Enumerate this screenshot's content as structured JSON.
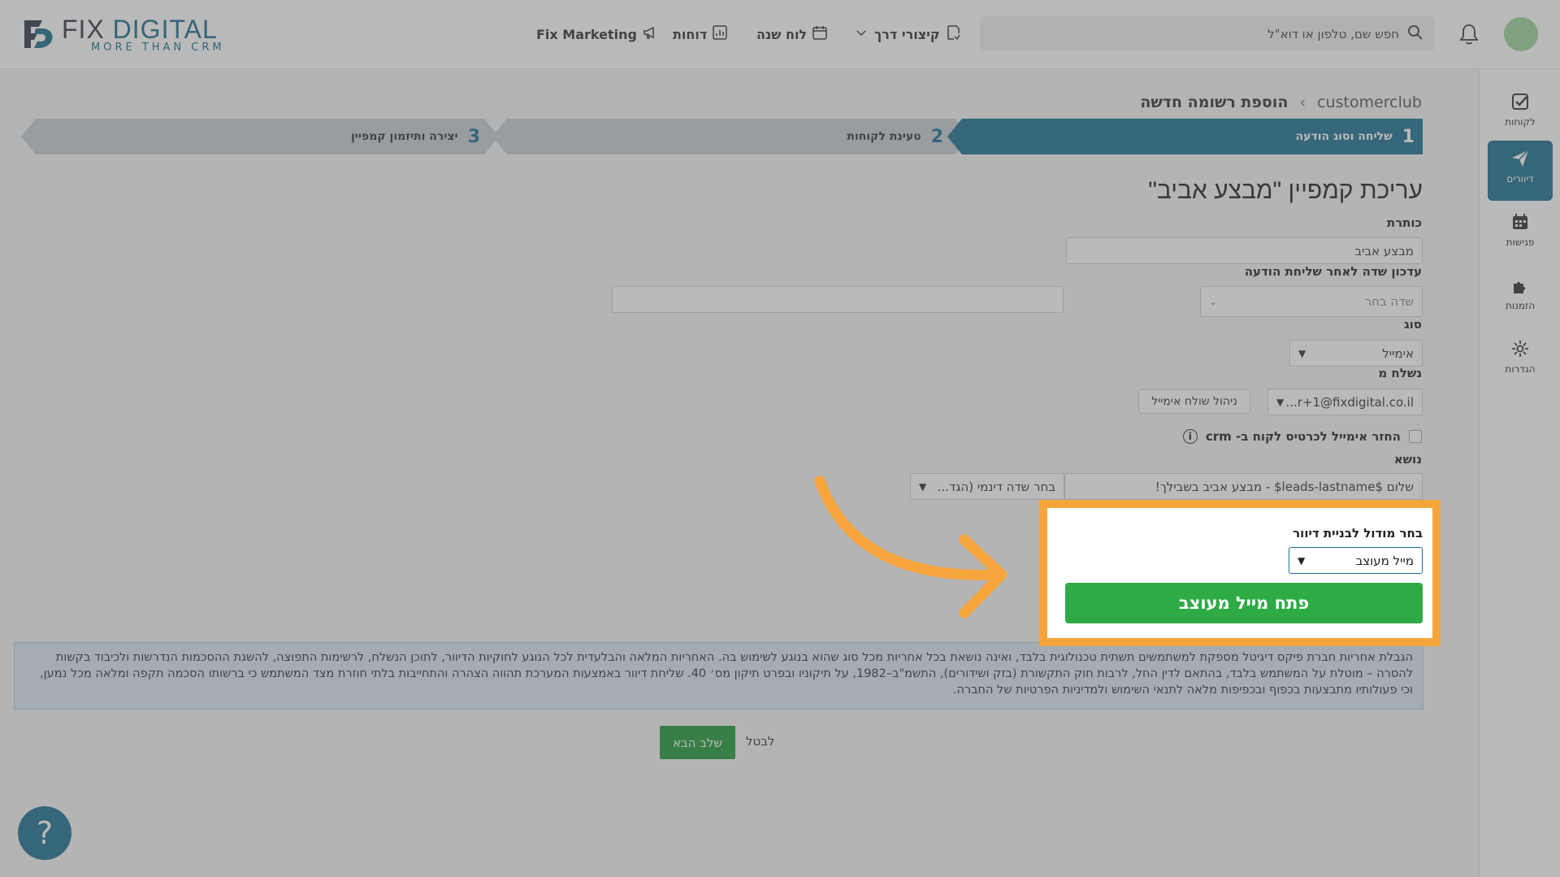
{
  "header": {
    "logo_title_a": "FIX ",
    "logo_title_b": "DIGITAL",
    "logo_sub": "MORE THAN CRM",
    "nav": {
      "marketing": "Fix Marketing",
      "reports": "דוחות",
      "calendar": "לוח שנה",
      "shortcuts": "קיצורי דרך"
    },
    "search_placeholder": "חפש שם, טלפון או דוא\"ל"
  },
  "sidebar": {
    "items": [
      {
        "label": "לקוחות",
        "icon": "checkbox-icon"
      },
      {
        "label": "דיוורים",
        "icon": "send-icon"
      },
      {
        "label": "פגישות",
        "icon": "calendar-icon"
      },
      {
        "label": "הזמנות",
        "icon": "puzzle-icon"
      },
      {
        "label": "הגדרות",
        "icon": "gear-icon"
      }
    ]
  },
  "breadcrumb": {
    "root": "customerclub",
    "separator": "›",
    "current": "הוספת רשומה חדשה"
  },
  "steps": [
    {
      "num": "1",
      "label": "שליחה וסוג הודעה"
    },
    {
      "num": "2",
      "label": "טעינת לקוחות"
    },
    {
      "num": "3",
      "label": "יצירה ותיזמון קמפיין"
    }
  ],
  "page_title": "עריכת קמפיין \"מבצע אביב\"",
  "form": {
    "title_label": "כותרת",
    "title_value": "מבצע אביב",
    "update_label": "עדכון שדה לאחר שליחת הודעה",
    "update_placeholder": "שדה בחר",
    "type_label": "סוג",
    "type_value": "אימייל",
    "from_label": "נשלח מ",
    "from_value": "r+1@fixdigital.co.il...",
    "manage_sender": "ניהול שולח אימייל",
    "return_email": "החזר אימייל לכרטיס לקוח ב- crm",
    "subject_label": "נושא",
    "subject_value": "שלום $leads-lastname$ - מבצע אביב בשבילך!",
    "dynamic_field": "בחר שדה דינמי (הגד...",
    "module_label": "בחר מודול לבניית דיוור",
    "module_value": "מייל מעוצב",
    "open_designed": "פתח מייל מעוצב"
  },
  "disclaimer": "הגבלת אחריות חברת פיקס דיגיטל מספקת למשתמשים תשתית טכנולוגית בלבד, ואינה נושאת בכל אחריות מכל סוג שהוא בנוגע לשימוש בה. האחריות המלאה והבלעדית לכל הנוגע לחוקיות הדיוור, לתוכן הנשלח, לרשימות התפוצה, להשגת ההסכמות הנדרשות ולכיבוד בקשות להסרה – מוטלת על המשתמש בלבד, בהתאם לדין החל, לרבות חוק התקשורת (בזק ושידורים), התשמ\"ב–1982, על תיקוניו ובפרט תיקון מס׳ 40. שליחת דיוור באמצעות המערכת תהווה הצהרה והתחייבות בלתי חוזרת מצד המשתמש כי ברשותו הסכמה תקפה ומלאה מכל נמען, וכי פעולותיו מתבצעות בכפוף ובכפיפות מלאה לתנאי השימוש ולמדיניות הפרטיות של החברה.",
  "actions": {
    "next": "שלב הבא",
    "cancel": "לבטל"
  },
  "help": "?",
  "colors": {
    "brand": "#1b6e8f",
    "highlight": "#f6a53c",
    "green": "#2eab45"
  }
}
